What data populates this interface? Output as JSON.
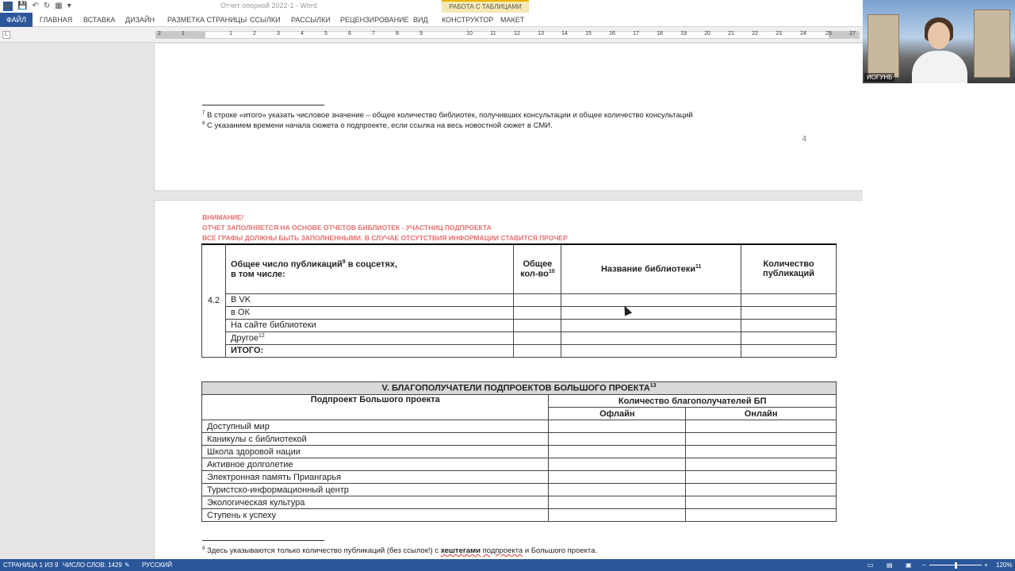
{
  "titlebar": {
    "doc_title": "Отчет опорной 2022-1 - Word",
    "table_tools": "РАБОТА С ТАБЛИЦАМИ"
  },
  "ribbon": {
    "tabs": [
      "ФАЙЛ",
      "ГЛАВНАЯ",
      "ВСТАВКА",
      "ДИЗАЙН",
      "РАЗМЕТКА СТРАНИЦЫ",
      "ССЫЛКИ",
      "РАССЫЛКИ",
      "РЕЦЕНЗИРОВАНИЕ",
      "ВИД",
      "КОНСТРУКТОР",
      "МАКЕТ"
    ]
  },
  "ruler": {
    "numbers": [
      "2",
      "1",
      "1",
      "2",
      "3",
      "4",
      "5",
      "6",
      "7",
      "8",
      "9",
      "10",
      "11",
      "12",
      "13",
      "14",
      "15",
      "16",
      "17",
      "18",
      "19",
      "20",
      "21",
      "22",
      "23",
      "24",
      "25",
      "27"
    ]
  },
  "page1": {
    "fn7_num": "7",
    "fn7": " В строке «итого» указать числовое значение – общее количество библиотек, получивших консультации и общее количество консультаций",
    "fn8_num": "8",
    "fn8": " С указанием времени начала сюжета о подпроекте, если ссылка на весь новостной сюжет в СМИ.",
    "page_number": "4"
  },
  "page2": {
    "warnings": [
      "ВНИМАНИЕ!",
      "ОТЧЕТ ЗАПОЛНЯЕТСЯ НА ОСНОВЕ ОТЧЕТОВ БИБЛИОТЕК - УЧАСТНИЦ ПОДПРОЕКТА",
      "ВСЕ ГРАФЫ ДОЛЖНЫ БЫТЬ ЗАПОЛНЕННЫМИ. В СЛУЧАЕ ОТСУТСТВИЯ ИНФОРМАЦИИ СТАВИТСЯ ПРОЧЕР"
    ],
    "table1": {
      "row_num": "4.2",
      "head_line1": "Общее число публикаций",
      "head_sup": "9",
      "head_line1_tail": " в соцсетях,",
      "head_line2": "в том числе:",
      "col_total_line1": "Общее",
      "col_total_line2": "кол-во",
      "col_total_sup": "10",
      "col_library": "Название библиотеки",
      "col_library_sup": "11",
      "col_count_line1": "Количество",
      "col_count_line2": "публикаций",
      "rows": [
        "В VK",
        "в ОК",
        "На сайте библиотеки",
        "Другое"
      ],
      "other_sup": "12",
      "total_label": "ИТОГО:"
    },
    "table2": {
      "section_title": "V. БЛАГОПОЛУЧАТЕЛИ ПОДПРОЕКТОВ БОЛЬШОГО ПРОЕКТА",
      "section_sup": "13",
      "col_subproject": "Подпроект Большого проекта",
      "col_beneficiaries": "Количество благополучателей БП",
      "col_offline": "Офлайн",
      "col_online": "Онлайн",
      "rows": [
        "Доступный мир",
        "Каникулы с библиотекой",
        "Школа здоровой нации",
        "Активное долголетие",
        "Электронная память Приангарья",
        "Туристско-информационный центр",
        "Экологическая культура",
        "Ступень к успеху"
      ]
    },
    "fn9_num": "9",
    "fn9_a": " Здесь указываются только количество публикаций (без ссылок!) с ",
    "fn9_b": "хештегами",
    "fn9_c": " ",
    "fn9_d": "подпроекта",
    "fn9_e": " и Большого проекта."
  },
  "video": {
    "participant_name": "ИОГУНБ"
  },
  "statusbar": {
    "page": "СТРАНИЦА 1 ИЗ 9",
    "words": "ЧИСЛО СЛОВ: 1429",
    "language": "РУССКИЙ",
    "zoom": "120%"
  },
  "colors": {
    "word_blue": "#2b579a",
    "warning_red": "#e76f6f",
    "section_gray": "#d9d9d9"
  }
}
